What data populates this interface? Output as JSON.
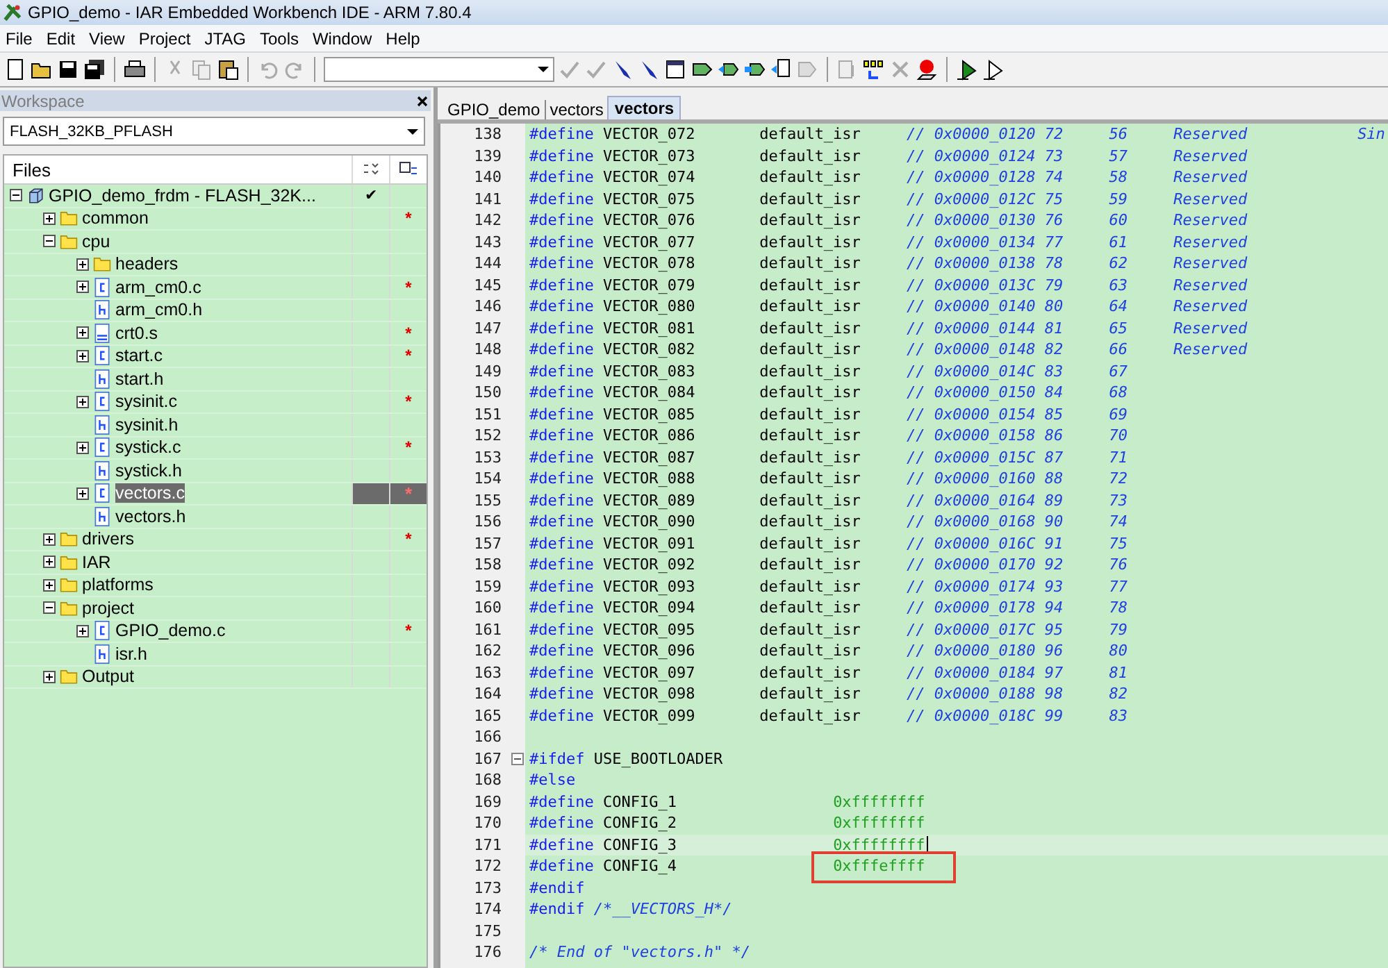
{
  "window": {
    "title": "GPIO_demo - IAR Embedded Workbench IDE - ARM 7.80.4"
  },
  "menu": [
    "File",
    "Edit",
    "View",
    "Project",
    "JTAG",
    "Tools",
    "Window",
    "Help"
  ],
  "workspace": {
    "title": "Workspace",
    "config": "FLASH_32KB_PFLASH",
    "files_header": "Files",
    "tree": [
      {
        "label": "GPIO_demo_frdm - FLASH_32K...",
        "kind": "project",
        "expanded": true,
        "selected": false,
        "check": "✔",
        "children": [
          {
            "label": "common",
            "kind": "folder",
            "expanded": false,
            "selected": false,
            "status": "*"
          },
          {
            "label": "cpu",
            "kind": "folder",
            "expanded": true,
            "selected": false,
            "children": [
              {
                "label": "headers",
                "kind": "folder",
                "expanded": false,
                "selected": false
              },
              {
                "label": "arm_cm0.c",
                "kind": "c",
                "expanded": false,
                "selected": false,
                "status": "*"
              },
              {
                "label": "arm_cm0.h",
                "kind": "h",
                "selected": false
              },
              {
                "label": "crt0.s",
                "kind": "asm",
                "expanded": false,
                "selected": false,
                "status": "*"
              },
              {
                "label": "start.c",
                "kind": "c",
                "expanded": false,
                "selected": false,
                "status": "*"
              },
              {
                "label": "start.h",
                "kind": "h",
                "selected": false
              },
              {
                "label": "sysinit.c",
                "kind": "c",
                "expanded": false,
                "selected": false,
                "status": "*"
              },
              {
                "label": "sysinit.h",
                "kind": "h",
                "selected": false
              },
              {
                "label": "systick.c",
                "kind": "c",
                "expanded": false,
                "selected": false,
                "status": "*"
              },
              {
                "label": "systick.h",
                "kind": "h",
                "selected": false
              },
              {
                "label": "vectors.c",
                "kind": "c",
                "expanded": false,
                "selected": true,
                "status": "*"
              },
              {
                "label": "vectors.h",
                "kind": "h",
                "selected": false
              }
            ]
          },
          {
            "label": "drivers",
            "kind": "folder",
            "expanded": false,
            "selected": false,
            "status": "*"
          },
          {
            "label": "IAR",
            "kind": "folder",
            "expanded": false,
            "selected": false
          },
          {
            "label": "platforms",
            "kind": "folder",
            "expanded": false,
            "selected": false
          },
          {
            "label": "project",
            "kind": "folder",
            "expanded": true,
            "selected": false,
            "children": [
              {
                "label": "GPIO_demo.c",
                "kind": "c",
                "expanded": false,
                "selected": false,
                "status": "*"
              },
              {
                "label": "isr.h",
                "kind": "h",
                "selected": false
              }
            ]
          },
          {
            "label": "Output",
            "kind": "folder",
            "expanded": false,
            "selected": false
          }
        ]
      }
    ]
  },
  "editor": {
    "tabs": [
      {
        "label": "GPIO_demo",
        "selected": false
      },
      {
        "label": "vectors",
        "selected": false
      },
      {
        "label": "vectors",
        "selected": true
      }
    ],
    "lines": [
      {
        "num": "138",
        "kind": "vector",
        "keyword": "#define",
        "name": "VECTOR_072",
        "handler": "default_isr",
        "comment": "// 0x0000_0120 72",
        "irq": "56",
        "desc": "Reserved",
        "note": "Sin"
      },
      {
        "num": "139",
        "kind": "vector",
        "keyword": "#define",
        "name": "VECTOR_073",
        "handler": "default_isr",
        "comment": "// 0x0000_0124 73",
        "irq": "57",
        "desc": "Reserved"
      },
      {
        "num": "140",
        "kind": "vector",
        "keyword": "#define",
        "name": "VECTOR_074",
        "handler": "default_isr",
        "comment": "// 0x0000_0128 74",
        "irq": "58",
        "desc": "Reserved"
      },
      {
        "num": "141",
        "kind": "vector",
        "keyword": "#define",
        "name": "VECTOR_075",
        "handler": "default_isr",
        "comment": "// 0x0000_012C 75",
        "irq": "59",
        "desc": "Reserved"
      },
      {
        "num": "142",
        "kind": "vector",
        "keyword": "#define",
        "name": "VECTOR_076",
        "handler": "default_isr",
        "comment": "// 0x0000_0130 76",
        "irq": "60",
        "desc": "Reserved"
      },
      {
        "num": "143",
        "kind": "vector",
        "keyword": "#define",
        "name": "VECTOR_077",
        "handler": "default_isr",
        "comment": "// 0x0000_0134 77",
        "irq": "61",
        "desc": "Reserved"
      },
      {
        "num": "144",
        "kind": "vector",
        "keyword": "#define",
        "name": "VECTOR_078",
        "handler": "default_isr",
        "comment": "// 0x0000_0138 78",
        "irq": "62",
        "desc": "Reserved"
      },
      {
        "num": "145",
        "kind": "vector",
        "keyword": "#define",
        "name": "VECTOR_079",
        "handler": "default_isr",
        "comment": "// 0x0000_013C 79",
        "irq": "63",
        "desc": "Reserved"
      },
      {
        "num": "146",
        "kind": "vector",
        "keyword": "#define",
        "name": "VECTOR_080",
        "handler": "default_isr",
        "comment": "// 0x0000_0140 80",
        "irq": "64",
        "desc": "Reserved"
      },
      {
        "num": "147",
        "kind": "vector",
        "keyword": "#define",
        "name": "VECTOR_081",
        "handler": "default_isr",
        "comment": "// 0x0000_0144 81",
        "irq": "65",
        "desc": "Reserved"
      },
      {
        "num": "148",
        "kind": "vector",
        "keyword": "#define",
        "name": "VECTOR_082",
        "handler": "default_isr",
        "comment": "// 0x0000_0148 82",
        "irq": "66",
        "desc": "Reserved"
      },
      {
        "num": "149",
        "kind": "vector",
        "keyword": "#define",
        "name": "VECTOR_083",
        "handler": "default_isr",
        "comment": "// 0x0000_014C 83",
        "irq": "67"
      },
      {
        "num": "150",
        "kind": "vector",
        "keyword": "#define",
        "name": "VECTOR_084",
        "handler": "default_isr",
        "comment": "// 0x0000_0150 84",
        "irq": "68"
      },
      {
        "num": "151",
        "kind": "vector",
        "keyword": "#define",
        "name": "VECTOR_085",
        "handler": "default_isr",
        "comment": "// 0x0000_0154 85",
        "irq": "69"
      },
      {
        "num": "152",
        "kind": "vector",
        "keyword": "#define",
        "name": "VECTOR_086",
        "handler": "default_isr",
        "comment": "// 0x0000_0158 86",
        "irq": "70"
      },
      {
        "num": "153",
        "kind": "vector",
        "keyword": "#define",
        "name": "VECTOR_087",
        "handler": "default_isr",
        "comment": "// 0x0000_015C 87",
        "irq": "71"
      },
      {
        "num": "154",
        "kind": "vector",
        "keyword": "#define",
        "name": "VECTOR_088",
        "handler": "default_isr",
        "comment": "// 0x0000_0160 88",
        "irq": "72"
      },
      {
        "num": "155",
        "kind": "vector",
        "keyword": "#define",
        "name": "VECTOR_089",
        "handler": "default_isr",
        "comment": "// 0x0000_0164 89",
        "irq": "73"
      },
      {
        "num": "156",
        "kind": "vector",
        "keyword": "#define",
        "name": "VECTOR_090",
        "handler": "default_isr",
        "comment": "// 0x0000_0168 90",
        "irq": "74"
      },
      {
        "num": "157",
        "kind": "vector",
        "keyword": "#define",
        "name": "VECTOR_091",
        "handler": "default_isr",
        "comment": "// 0x0000_016C 91",
        "irq": "75"
      },
      {
        "num": "158",
        "kind": "vector",
        "keyword": "#define",
        "name": "VECTOR_092",
        "handler": "default_isr",
        "comment": "// 0x0000_0170 92",
        "irq": "76"
      },
      {
        "num": "159",
        "kind": "vector",
        "keyword": "#define",
        "name": "VECTOR_093",
        "handler": "default_isr",
        "comment": "// 0x0000_0174 93",
        "irq": "77"
      },
      {
        "num": "160",
        "kind": "vector",
        "keyword": "#define",
        "name": "VECTOR_094",
        "handler": "default_isr",
        "comment": "// 0x0000_0178 94",
        "irq": "78"
      },
      {
        "num": "161",
        "kind": "vector",
        "keyword": "#define",
        "name": "VECTOR_095",
        "handler": "default_isr",
        "comment": "// 0x0000_017C 95",
        "irq": "79"
      },
      {
        "num": "162",
        "kind": "vector",
        "keyword": "#define",
        "name": "VECTOR_096",
        "handler": "default_isr",
        "comment": "// 0x0000_0180 96",
        "irq": "80"
      },
      {
        "num": "163",
        "kind": "vector",
        "keyword": "#define",
        "name": "VECTOR_097",
        "handler": "default_isr",
        "comment": "// 0x0000_0184 97",
        "irq": "81"
      },
      {
        "num": "164",
        "kind": "vector",
        "keyword": "#define",
        "name": "VECTOR_098",
        "handler": "default_isr",
        "comment": "// 0x0000_0188 98",
        "irq": "82"
      },
      {
        "num": "165",
        "kind": "vector",
        "keyword": "#define",
        "name": "VECTOR_099",
        "handler": "default_isr",
        "comment": "// 0x0000_018C 99",
        "irq": "83"
      },
      {
        "num": "166",
        "kind": "blank"
      },
      {
        "num": "167",
        "kind": "ifdef",
        "keyword": "#ifdef",
        "text": "USE_BOOTLOADER",
        "fold": true
      },
      {
        "num": "168",
        "kind": "directive",
        "keyword": "#else"
      },
      {
        "num": "169",
        "kind": "config",
        "keyword": "#define",
        "name": "CONFIG_1",
        "value": "0xffffffff",
        "current": false,
        "boxed": false
      },
      {
        "num": "170",
        "kind": "config",
        "keyword": "#define",
        "name": "CONFIG_2",
        "value": "0xffffffff",
        "current": false,
        "boxed": false
      },
      {
        "num": "171",
        "kind": "config",
        "keyword": "#define",
        "name": "CONFIG_3",
        "value": "0xffffffff",
        "current": true,
        "boxed": false
      },
      {
        "num": "172",
        "kind": "config",
        "keyword": "#define",
        "name": "CONFIG_4",
        "value": "0xfffeffff",
        "current": false,
        "boxed": true
      },
      {
        "num": "173",
        "kind": "directive",
        "keyword": "#endif"
      },
      {
        "num": "174",
        "kind": "endif_comment",
        "keyword": "#endif",
        "comment": "/*__VECTORS_H*/"
      },
      {
        "num": "175",
        "kind": "blank"
      },
      {
        "num": "176",
        "kind": "comment",
        "comment": "/* End of \"vectors.h\" */"
      }
    ]
  }
}
